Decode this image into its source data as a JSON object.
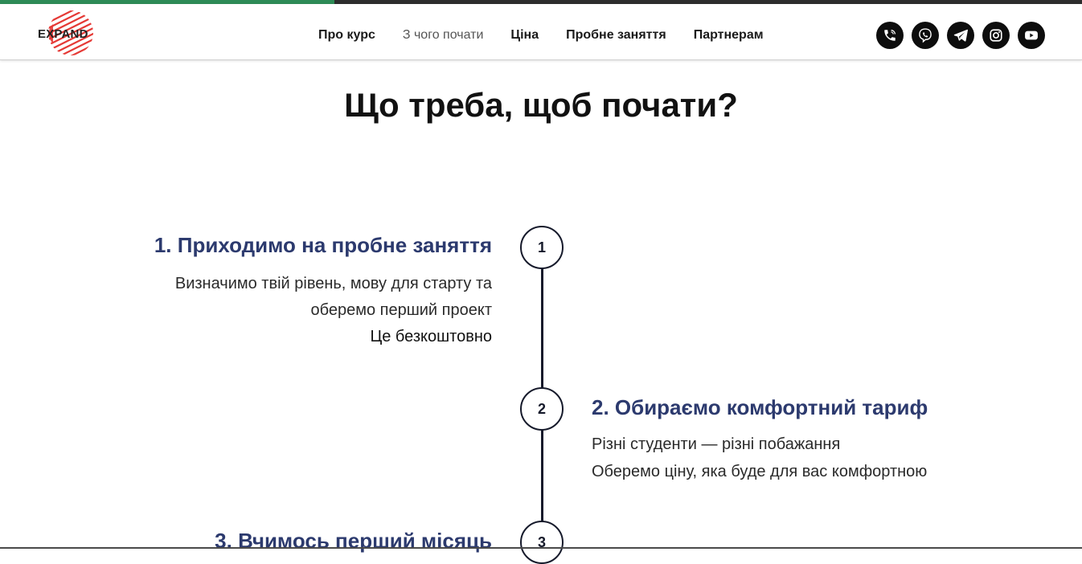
{
  "progress": {
    "fraction": 0.309,
    "track_color": "#2d2d2d",
    "fill_color": "#2e8b57"
  },
  "header": {
    "logo_text": "EXPAND",
    "nav": [
      {
        "label": "Про курс",
        "active": false
      },
      {
        "label": "З чого почати",
        "active": true
      },
      {
        "label": "Ціна",
        "active": false
      },
      {
        "label": "Пробне заняття",
        "active": false
      },
      {
        "label": "Партнерам",
        "active": false
      }
    ],
    "socials": [
      {
        "icon": "phone-icon"
      },
      {
        "icon": "viber-icon"
      },
      {
        "icon": "telegram-icon"
      },
      {
        "icon": "instagram-icon"
      },
      {
        "icon": "youtube-icon"
      }
    ]
  },
  "main": {
    "title": "Що треба, щоб почати?",
    "steps": [
      {
        "number": "1",
        "title": "1. Приходимо на пробне заняття",
        "lines": [
          "Визначимо твій рівень, мову для старту та",
          "оберемо перший проект",
          "Це безкоштовно"
        ]
      },
      {
        "number": "2",
        "title": "2. Обираємо комфортний тариф",
        "lines": [
          "Різні студенти — різні побажання",
          "Оберемо ціну, яка буде для вас комфортною"
        ]
      },
      {
        "number": "3",
        "title": "3. Вчимось перший місяць",
        "lines": []
      }
    ]
  },
  "colors": {
    "step_title": "#2c3a6e",
    "timeline": "#161a2b",
    "logo_red": "#e53935"
  }
}
